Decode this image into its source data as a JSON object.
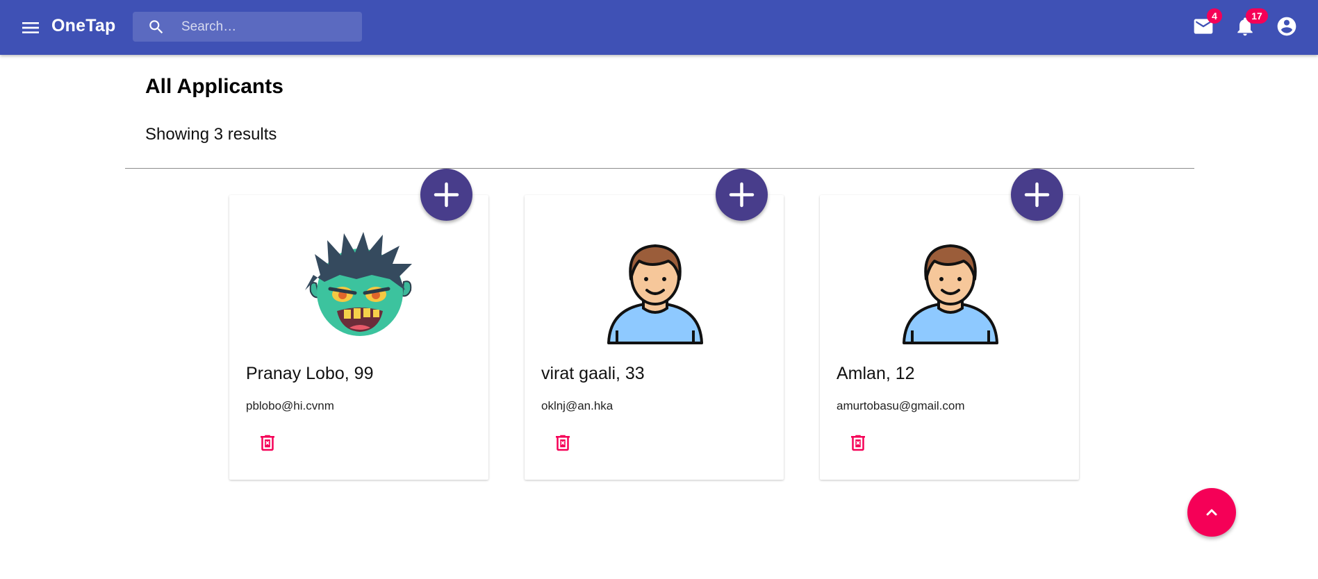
{
  "app": {
    "title": "OneTap"
  },
  "search": {
    "placeholder": "Search…",
    "value": ""
  },
  "header": {
    "mail": {
      "icon": "mail-icon",
      "badge": "4"
    },
    "notifications": {
      "icon": "bell-icon",
      "badge": "17"
    },
    "account": {
      "icon": "account-circle-icon"
    }
  },
  "page": {
    "title": "All Applicants",
    "results_text": "Showing 3 results"
  },
  "applicants": [
    {
      "name": "Pranay Lobo, 99",
      "email": "pblobo@hi.cvnm",
      "avatar": "zombie-avatar"
    },
    {
      "name": "virat gaali, 33",
      "email": "oklnj@an.hka",
      "avatar": "man-avatar"
    },
    {
      "name": "Amlan, 12",
      "email": "amurtobasu@gmail.com",
      "avatar": "man-avatar"
    }
  ],
  "colors": {
    "appbar": "#3f51b5",
    "accent": "#f50057",
    "fab_add": "#483d8b"
  }
}
